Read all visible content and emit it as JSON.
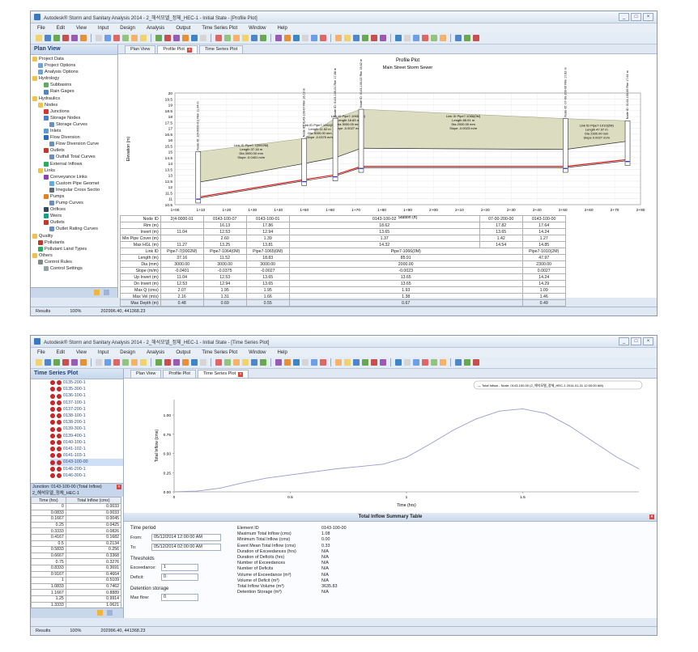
{
  "top": {
    "title": "Autodesk® Storm and Sanitary Analysis 2014 - 2_해석모델_정체_HEC-1 - Initial State - [Profile Plot]",
    "menu": [
      "File",
      "Edit",
      "View",
      "Input",
      "Design",
      "Analysis",
      "Output",
      "Time Series Plot",
      "Window",
      "Help"
    ],
    "panel_title": "Plan View",
    "tree": [
      {
        "label": "Project Data",
        "level": 0,
        "icon": "folder-icon"
      },
      {
        "label": "Project Options",
        "level": 1,
        "icon": "options-icon"
      },
      {
        "label": "Analysis Options",
        "level": 1,
        "icon": "options-icon"
      },
      {
        "label": "Hydrology",
        "level": 0,
        "icon": "folder-icon"
      },
      {
        "label": "Subbasins",
        "level": 2,
        "icon": "subbasin-icon"
      },
      {
        "label": "Rain Gages",
        "level": 2,
        "icon": "gage-icon"
      },
      {
        "label": "Hydraulics",
        "level": 0,
        "icon": "folder-icon"
      },
      {
        "label": "Nodes",
        "level": 1,
        "icon": "folder-icon"
      },
      {
        "label": "Junctions",
        "level": 2,
        "icon": "junction-icon"
      },
      {
        "label": "Storage Nodes",
        "level": 2,
        "icon": "storage-icon"
      },
      {
        "label": "Storage Curves",
        "level": 3,
        "icon": "curve-icon"
      },
      {
        "label": "Inlets",
        "level": 2,
        "icon": "inlet-icon"
      },
      {
        "label": "Flow Diversion",
        "level": 2,
        "icon": "diversion-icon"
      },
      {
        "label": "Flow Diversion Curve",
        "level": 3,
        "icon": "curve-icon"
      },
      {
        "label": "Outlets",
        "level": 2,
        "icon": "outlet-icon"
      },
      {
        "label": "Outfall Total Curves",
        "level": 3,
        "icon": "curve-icon"
      },
      {
        "label": "External Inflows",
        "level": 2,
        "icon": "inflow-icon"
      },
      {
        "label": "Links",
        "level": 1,
        "icon": "folder-icon"
      },
      {
        "label": "Conveyance Links",
        "level": 2,
        "icon": "link-icon"
      },
      {
        "label": "Custom Pipe Geomet",
        "level": 3,
        "icon": "pipe-icon"
      },
      {
        "label": "Irregular Cross Sectio",
        "level": 3,
        "icon": "section-icon"
      },
      {
        "label": "Pumps",
        "level": 2,
        "icon": "pump-icon"
      },
      {
        "label": "Pump Curves",
        "level": 3,
        "icon": "curve-icon"
      },
      {
        "label": "Orifices",
        "level": 2,
        "icon": "orifice-icon"
      },
      {
        "label": "Weirs",
        "level": 2,
        "icon": "weir-icon"
      },
      {
        "label": "Outlets",
        "level": 2,
        "icon": "outlet-icon"
      },
      {
        "label": "Outlet Rating Curves",
        "level": 3,
        "icon": "curve-icon"
      },
      {
        "label": "Quality",
        "level": 0,
        "icon": "folder-icon"
      },
      {
        "label": "Pollutants",
        "level": 1,
        "icon": "pollutant-icon"
      },
      {
        "label": "Pollutant Land Types",
        "level": 1,
        "icon": "landuse-icon"
      },
      {
        "label": "Others",
        "level": 0,
        "icon": "folder-icon"
      },
      {
        "label": "Control Rules",
        "level": 1,
        "icon": "rules-icon"
      },
      {
        "label": "Control Settings",
        "level": 2,
        "icon": "settings-icon"
      }
    ],
    "tabs": [
      "Plan View",
      "Profile Plot",
      "Time Series Plot"
    ],
    "plot_title": "Profile Plot",
    "plot_subtitle": "Main Street Storm Sewer",
    "ylabel": "Elevation (m)",
    "xlabel": "Station (ft)",
    "y_ticks": [
      "20",
      "19.5",
      "19",
      "18.5",
      "18",
      "17.5",
      "17",
      "16.5",
      "16",
      "15.5",
      "15",
      "14.5",
      "14",
      "13.5",
      "13",
      "12.5",
      "12",
      "11.5",
      "11",
      "10.5"
    ],
    "x_ticks": [
      "1+00",
      "1+10",
      "1+20",
      "1+30",
      "1+40",
      "1+50",
      "1+60",
      "1+70",
      "1+80",
      "1+90",
      "2+00",
      "2+10",
      "2+20",
      "2+30",
      "2+40",
      "2+50",
      "2+60",
      "2+70",
      "2+80"
    ],
    "link_labels": [
      {
        "l1": "Link ID Pipe7-7(0002M)",
        "l2": "Length 37.16 m",
        "l3": "Dia 3000.00 mm",
        "l4": "Slope -0.0401 m/m"
      },
      {
        "l1": "Link ID Pipe7-1064(0M)",
        "l2": "Length 11.52 m",
        "l3": "Dia 3000.00 mm",
        "l4": "Slope -0.0375 m/m"
      },
      {
        "l1": "Link ID Pipe7-1065(0M)",
        "l2": "Length 18.83 m",
        "l3": "Dia 3000.00 mm",
        "l4": "Slope -0.0027 m/m"
      },
      {
        "l1": "Link ID Pipe7-1066(0M)",
        "l2": "Length 85.91 m",
        "l3": "Dia 2000.00 mm",
        "l4": "Slope -0.0023 m/m"
      },
      {
        "l1": "Link ID Pipe7-1010(2M)",
        "l2": "Length 47.97 m",
        "l3": "Dia 2300.00 mm",
        "l4": "Slope 0.0027 m/m"
      }
    ],
    "node_labels": [
      "Node ID: 2(4-0000-01)  Rim 11.04 m",
      "Node ID: 0143-100-07  Rim 16.13 m",
      "Node ID: 0143-100-01  Rim 17.86 m",
      "Node ID: 0143-100-02  Rim 18.62 m",
      "Node ID: 07-00-200-00  Rim 17.82 m",
      "Node ID: 0143-100-00  Rim 17.64 m"
    ],
    "table": {
      "rows": [
        [
          "Node ID",
          "2(4-0000-01",
          "0143-100-07",
          "0143-100-01",
          "0143-100-02",
          "07-00-200-00",
          "0143-100-00"
        ],
        [
          "Rim (m)",
          "",
          "16.13",
          "17.86",
          "18.62",
          "17.82",
          "17.64"
        ],
        [
          "Invert (m)",
          "11.04",
          "12.53",
          "12.94",
          "13.65",
          "13.65",
          "14.24"
        ],
        [
          "Min Pipe Cover (m)",
          "",
          "2.60",
          "1.39",
          "1.37",
          "1.42",
          "1.27"
        ],
        [
          "Max HGL (m)",
          "11.27",
          "13.25",
          "13.81",
          "14.32",
          "14.54",
          "14.85"
        ]
      ],
      "link_rows": [
        [
          "Link ID",
          "Pipe7-7(0002M)",
          "Pipe7-1064(0M)",
          "Pipe7-1065(0M)",
          "Pipe7-1066(0M)",
          "Pipe7-1010(2M)"
        ],
        [
          "Length (m)",
          "37.16",
          "11.52",
          "18.83",
          "85.91",
          "47.97"
        ],
        [
          "Dia (mm)",
          "3000.00",
          "3000.00",
          "3000.00",
          "2000.00",
          "2300.00"
        ],
        [
          "Slope (m/m)",
          "-0.0401",
          "-0.0375",
          "-0.0027",
          "-0.0023",
          "0.0027"
        ],
        [
          "Up Invert (m)",
          "11.04",
          "12.53",
          "13.65",
          "13.65",
          "14.24"
        ],
        [
          "Dn Invert (m)",
          "12.53",
          "12.94",
          "13.65",
          "13.65",
          "14.29"
        ],
        [
          "Max Q (cms)",
          "2.07",
          "1.95",
          "1.95",
          "1.93",
          "1.09"
        ],
        [
          "Max Vel (m/s)",
          "2.16",
          "1.31",
          "1.66",
          "1.38",
          "1.46"
        ],
        [
          "Max Depth (m)",
          "0.48",
          "0.69",
          "0.55",
          "0.67",
          "0.49"
        ]
      ]
    },
    "status_results": "Results",
    "status_zoom": "100%",
    "status_coords": "202996.40, 441368.23"
  },
  "bottom": {
    "title": "Autodesk® Storm and Sanitary Analysis 2014 - 2_해석모델_정체_HEC-1 - Initial State - [Time Series Plot]",
    "panel_title": "Time Series Plot",
    "node_list": [
      "0135-200-1",
      "0135-300-1",
      "0136-100-1",
      "0137-100-1",
      "0137-200-1",
      "0138-100-1",
      "0138-200-1",
      "0139-300-1",
      "0139-400-1",
      "0140-100-1",
      "0141-102-1",
      "0141-103-1",
      "0143-100-00",
      "0146-200-1",
      "0146-300-1"
    ],
    "subpanel_title": "Junction: 0143-100-00 (Total Inflow)",
    "subpanel_sub": "2_해석모델_정체_HEC-1",
    "grid_head": [
      "Time (hrs)",
      "Total Inflow (cms)"
    ],
    "grid_rows": [
      [
        "0",
        "0.0033"
      ],
      [
        "0.0833",
        "0.0033"
      ],
      [
        "0.1667",
        "0.0045"
      ],
      [
        "0.25",
        "0.0425"
      ],
      [
        "0.3333",
        "0.0826"
      ],
      [
        "0.4167",
        "0.1682"
      ],
      [
        "0.5",
        "0.2134"
      ],
      [
        "0.5833",
        "0.256"
      ],
      [
        "0.6667",
        "0.3368"
      ],
      [
        "0.75",
        "0.3276"
      ],
      [
        "0.8333",
        "0.3691"
      ],
      [
        "0.9167",
        "0.4664"
      ],
      [
        "1",
        "0.5109"
      ],
      [
        "1.0833",
        "0.7462"
      ],
      [
        "1.1667",
        "0.8889"
      ],
      [
        "1.25",
        "0.9914"
      ],
      [
        "1.3333",
        "1.0621"
      ]
    ],
    "legend": "— Total Inflow - Node: 0143-100-00 (2_해석모델_정체_HEC-1 2014-01-31 12:00:00 AM)",
    "ylabel": "Total Inflow (cms)",
    "xlabel": "Time (hrs)",
    "y_ticks": [
      "0.00",
      "0.25",
      "0.50",
      "0.75",
      "1.00"
    ],
    "x_ticks": [
      "0",
      "0.5",
      "1",
      "1.5"
    ],
    "summary_title": "Total Inflow Summary Table",
    "time_period_label": "Time period",
    "from_label": "From:",
    "from_value": "05/12/2014 12:00:00 AM",
    "to_label": "To:",
    "to_value": "05/12/2014 02:00:00 AM",
    "thresholds_label": "Thresholds",
    "exceedance_label": "Exceedance:",
    "exceedance_value": "1",
    "deficit_label": "Deficit:",
    "deficit_value": "0",
    "detention_label": "Detention storage",
    "maxflow_label": "Max flow:",
    "maxflow_value": "0",
    "stats": [
      [
        "Element ID",
        "0143-100-00"
      ],
      [
        "Maximum Total Inflow (cms)",
        "1.08"
      ],
      [
        "Minimum Total Inflow (cms)",
        "0.00"
      ],
      [
        "Event Mean Total Inflow (cms)",
        "0.33"
      ],
      [
        "Duration of Exceedances (hrs)",
        "N/A"
      ],
      [
        "Duration of Deficits (hrs)",
        "N/A"
      ],
      [
        "Number of Exceedances",
        "N/A"
      ],
      [
        "Number of Deficits",
        "N/A"
      ],
      [
        "Volume of Exceedance (m³)",
        "N/A"
      ],
      [
        "Volume of Deficit (m³)",
        "N/A"
      ],
      [
        "Total Inflow Volume (m³)",
        "3635.83"
      ],
      [
        "Detention Storage (m³)",
        "N/A"
      ]
    ],
    "status_results": "Results",
    "status_zoom": "100%",
    "status_coords": "202996.40, 441368.23"
  },
  "chart_data": {
    "type": "line",
    "title": "",
    "xlabel": "Time (hrs)",
    "ylabel": "Total Inflow (cms)",
    "xlim": [
      0,
      2
    ],
    "ylim": [
      0,
      1.2
    ],
    "series": [
      {
        "name": "Total Inflow - Node: 0143-100-00",
        "x": [
          0,
          0.1,
          0.2,
          0.3,
          0.4,
          0.5,
          0.6,
          0.7,
          0.8,
          0.9,
          1.0,
          1.1,
          1.2,
          1.3,
          1.4,
          1.5,
          1.6,
          1.7,
          1.8,
          1.9,
          2.0
        ],
        "y": [
          0.0,
          0.01,
          0.05,
          0.12,
          0.18,
          0.22,
          0.26,
          0.3,
          0.33,
          0.36,
          0.45,
          0.62,
          0.8,
          0.95,
          1.05,
          1.08,
          1.02,
          0.86,
          0.66,
          0.46,
          0.3
        ]
      }
    ]
  },
  "colors": {
    "accent": "#2b5b9e",
    "pipe_fill": "#dcdcc0",
    "pipe_red": "#e02020",
    "pipe_blue": "#2b2bd8",
    "series": "#9b9bd4"
  }
}
